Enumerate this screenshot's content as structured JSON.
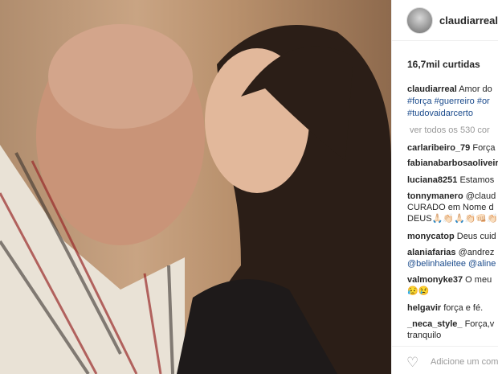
{
  "post": {
    "username": "claudiarreal",
    "likes": "16,7mil curtidas",
    "caption_user": "claudiarreal",
    "caption_text": "Amor do",
    "hashtags_line1": "#força #guerreiro #or",
    "hashtags_line2": "#tudovaidarcerto",
    "view_all": "ver todos os 530 cor"
  },
  "comments": [
    {
      "user": "carlaribeiro_79",
      "text": "Força"
    },
    {
      "user": "fabianabarbosaoliveir",
      "text": ""
    },
    {
      "user": "luciana8251",
      "text": "Estamos"
    },
    {
      "user": "tonnymanero",
      "text": "@claud"
    },
    {
      "user": "",
      "text": "CURADO em Nome d"
    },
    {
      "user": "",
      "text": "DEUS🙏🏻👏🏻🙏🏻👏🏻👊🏻👏🏻"
    },
    {
      "user": "monycatop",
      "text": "Deus cuid"
    },
    {
      "user": "alaniafarias",
      "text": "@andrez"
    },
    {
      "user": "",
      "text": "@belinhaleitee @aline"
    },
    {
      "user": "valmonyke37",
      "text": "O meu"
    },
    {
      "user": "",
      "text": "😥😢"
    },
    {
      "user": "helgavir",
      "text": "força e fé."
    },
    {
      "user": "_neca_style_",
      "text": "Força,v"
    },
    {
      "user": "",
      "text": "tranquilo"
    }
  ],
  "footer": {
    "add_comment": "Adicione um com"
  },
  "icons": {
    "like": "heart-icon",
    "avatar": "profile-avatar"
  }
}
